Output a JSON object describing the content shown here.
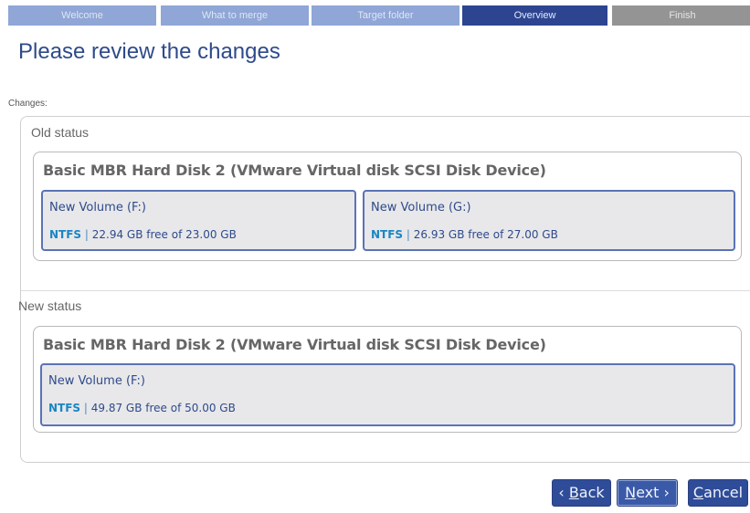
{
  "wizard_steps": [
    {
      "label": "Welcome"
    },
    {
      "label": "What to merge"
    },
    {
      "label": "Target folder"
    },
    {
      "label": "Overview"
    },
    {
      "label": "Finish"
    }
  ],
  "page_title": "Please review the changes",
  "changes_label": "Changes:",
  "old_status": {
    "label": "Old status",
    "disk_title": "Basic MBR Hard Disk 2 (VMware Virtual disk SCSI Disk Device)",
    "volumes": [
      {
        "name": "New Volume (F:)",
        "fs": "NTFS",
        "sep": " | ",
        "info": "22.94 GB free of 23.00 GB"
      },
      {
        "name": "New Volume (G:)",
        "fs": "NTFS",
        "sep": " | ",
        "info": "26.93 GB free of 27.00 GB"
      }
    ]
  },
  "new_status": {
    "label": "New status",
    "disk_title": "Basic MBR Hard Disk 2 (VMware Virtual disk SCSI Disk Device)",
    "volumes": [
      {
        "name": "New Volume (F:)",
        "fs": "NTFS",
        "sep": " | ",
        "info": "49.87 GB free of 50.00 GB"
      }
    ]
  },
  "buttons": {
    "back": {
      "prefix": "‹ ",
      "mnemonic": "B",
      "rest": "ack"
    },
    "next": {
      "mnemonic": "N",
      "rest": "ext",
      "suffix": " ›"
    },
    "cancel": {
      "mnemonic": "C",
      "rest": "ancel"
    }
  },
  "colors": {
    "active_step": "#2d4591",
    "step": "#8fa6d6",
    "finish_step": "#949494",
    "accent": "#2e4c98",
    "fs_label": "#1a86c4"
  }
}
